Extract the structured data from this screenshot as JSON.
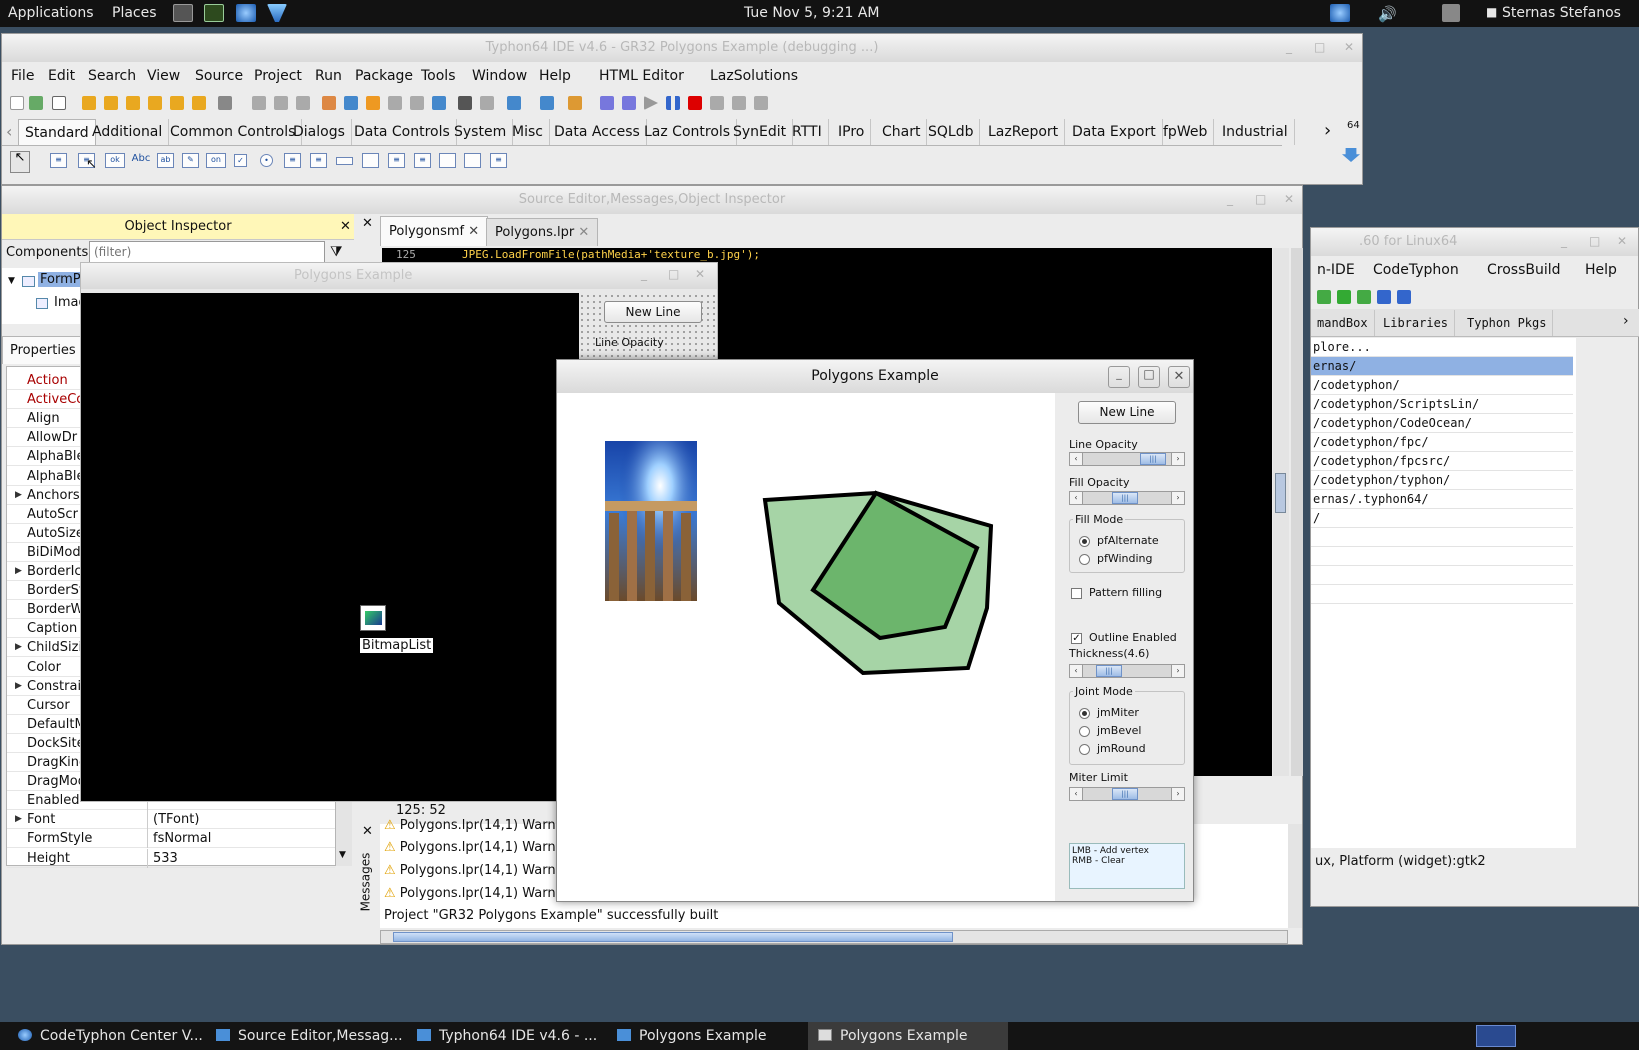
{
  "top_panel": {
    "applications": "Applications",
    "places": "Places",
    "clock": "Tue Nov  5,  9:21 AM",
    "user": "Sternas Stefanos"
  },
  "ide": {
    "title": "Typhon64 IDE v4.6 - GR32 Polygons Example (debugging ...)",
    "menu": [
      "File",
      "Edit",
      "Search",
      "View",
      "Source",
      "Project",
      "Run",
      "Package",
      "Tools",
      "Window",
      "Help",
      "HTML Editor",
      "LazSolutions"
    ],
    "palette_tabs": [
      "Standard",
      "Additional",
      "Common Controls",
      "Dialogs",
      "Data Controls",
      "System",
      "Misc",
      "Data Access",
      "Laz Controls",
      "SynEdit",
      "RTTI",
      "IPro",
      "Chart",
      "SQLdb",
      "LazReport",
      "Data Export",
      "fpWeb",
      "Industrial"
    ],
    "badge": "64",
    "std_components": {
      "ok": "ok",
      "abc": "Abc",
      "ab": "ab",
      "on": "on"
    }
  },
  "source_window": {
    "title": "Source Editor,Messages,Object Inspector",
    "tabs": [
      "Polygonsmf",
      "Polygons.lpr"
    ],
    "code_line": {
      "number": "125",
      "text": "JPEG.LoadFromFile(pathMedia+'texture_b.jpg');"
    },
    "cursor_pos": "125:  52",
    "messages_label": "Messages",
    "messages": [
      "Polygons.lpr(14,1) Warn",
      "Polygons.lpr(14,1) Warn",
      "Polygons.lpr(14,1) Warn",
      "Polygons.lpr(14,1) Warn"
    ],
    "build_status": "Project \"GR32 Polygons Example\" successfully built"
  },
  "object_inspector": {
    "title": "Object Inspector",
    "components_label": "Components",
    "filter_placeholder": "(filter)",
    "tree": [
      "FormP",
      "Imag"
    ],
    "properties_tab": "Properties",
    "properties": [
      {
        "name": "Action",
        "value": ""
      },
      {
        "name": "ActiveCo",
        "value": ""
      },
      {
        "name": "Align",
        "value": ""
      },
      {
        "name": "AllowDr",
        "value": ""
      },
      {
        "name": "AlphaBle",
        "value": ""
      },
      {
        "name": "AlphaBle",
        "value": ""
      },
      {
        "name": "Anchors",
        "value": ""
      },
      {
        "name": "AutoScr",
        "value": ""
      },
      {
        "name": "AutoSize",
        "value": ""
      },
      {
        "name": "BiDiMod",
        "value": ""
      },
      {
        "name": "BorderIc",
        "value": ""
      },
      {
        "name": "BorderSt",
        "value": ""
      },
      {
        "name": "BorderW",
        "value": ""
      },
      {
        "name": "Caption",
        "value": ""
      },
      {
        "name": "ChildSizi",
        "value": ""
      },
      {
        "name": "Color",
        "value": ""
      },
      {
        "name": "Constrai",
        "value": ""
      },
      {
        "name": "Cursor",
        "value": ""
      },
      {
        "name": "DefaultM",
        "value": ""
      },
      {
        "name": "DockSite",
        "value": ""
      },
      {
        "name": "DragKind",
        "value": ""
      },
      {
        "name": "DragMod",
        "value": ""
      },
      {
        "name": "Enabled",
        "value": ""
      },
      {
        "name": "Font",
        "value": "(TFont)"
      },
      {
        "name": "FormStyle",
        "value": "fsNormal"
      },
      {
        "name": "Height",
        "value": "533"
      }
    ]
  },
  "designer": {
    "title": "Polygons Example",
    "component_label": "BitmapList",
    "new_line": "New Line",
    "line_opacity": "Line Opacity"
  },
  "polygons_window": {
    "title": "Polygons Example",
    "new_line": "New Line",
    "line_opacity": "Line Opacity",
    "fill_opacity": "Fill Opacity",
    "fill_mode_title": "Fill Mode",
    "fill_modes": [
      "pfAlternate",
      "pfWinding"
    ],
    "fill_mode_selected": "pfAlternate",
    "pattern_filling": "Pattern filling",
    "pattern_filling_checked": false,
    "outline_enabled": "Outline Enabled",
    "outline_enabled_checked": true,
    "thickness": "Thickness(4.6)",
    "joint_mode_title": "Joint Mode",
    "joint_modes": [
      "jmMiter",
      "jmBevel",
      "jmRound"
    ],
    "joint_mode_selected": "jmMiter",
    "miter_limit": "Miter Limit",
    "hint_lines": [
      "LMB - Add vertex",
      "RMB - Clear"
    ],
    "polygon_fill": "#6cb56c",
    "polygon_fill_light": "#a6d4a6"
  },
  "center_window": {
    "title": ".60 for Linux64",
    "menu": [
      "n-IDE",
      "CodeTyphon",
      "CrossBuild",
      "Help"
    ],
    "tabs": [
      "mandBox",
      "Libraries",
      "Typhon Pkgs"
    ],
    "explore": "plore...",
    "paths": [
      "ernas/",
      "/codetyphon/",
      "/codetyphon/ScriptsLin/",
      "/codetyphon/CodeOcean/",
      "/codetyphon/fpc/",
      "/codetyphon/fpcsrc/",
      "/codetyphon/typhon/",
      "ernas/.typhon64/",
      "/"
    ],
    "status": "ux, Platform (widget):gtk2"
  },
  "taskbar": [
    "CodeTyphon Center V...",
    "Source Editor,Messag...",
    "Typhon64 IDE v4.6 - ...",
    "Polygons Example",
    "Polygons Example"
  ]
}
